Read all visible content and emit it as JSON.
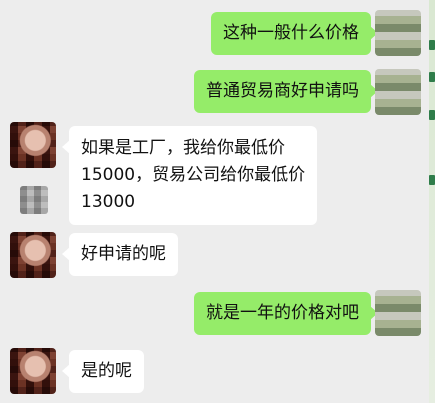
{
  "messages": [
    {
      "side": "me",
      "text": "这种一般什么价格"
    },
    {
      "side": "me",
      "text": "普通贸易商好申请吗"
    },
    {
      "side": "them",
      "lines": [
        "如果是工厂，我给你最低价",
        "15000，贸易公司给你最低价",
        "13000"
      ]
    },
    {
      "side": "them",
      "text": "好申请的呢"
    },
    {
      "side": "me",
      "text": "就是一年的价格对吧"
    },
    {
      "side": "them",
      "text": "是的呢"
    }
  ],
  "colors": {
    "background": "#ededed",
    "my_bubble": "#95ec69",
    "their_bubble": "#ffffff"
  }
}
